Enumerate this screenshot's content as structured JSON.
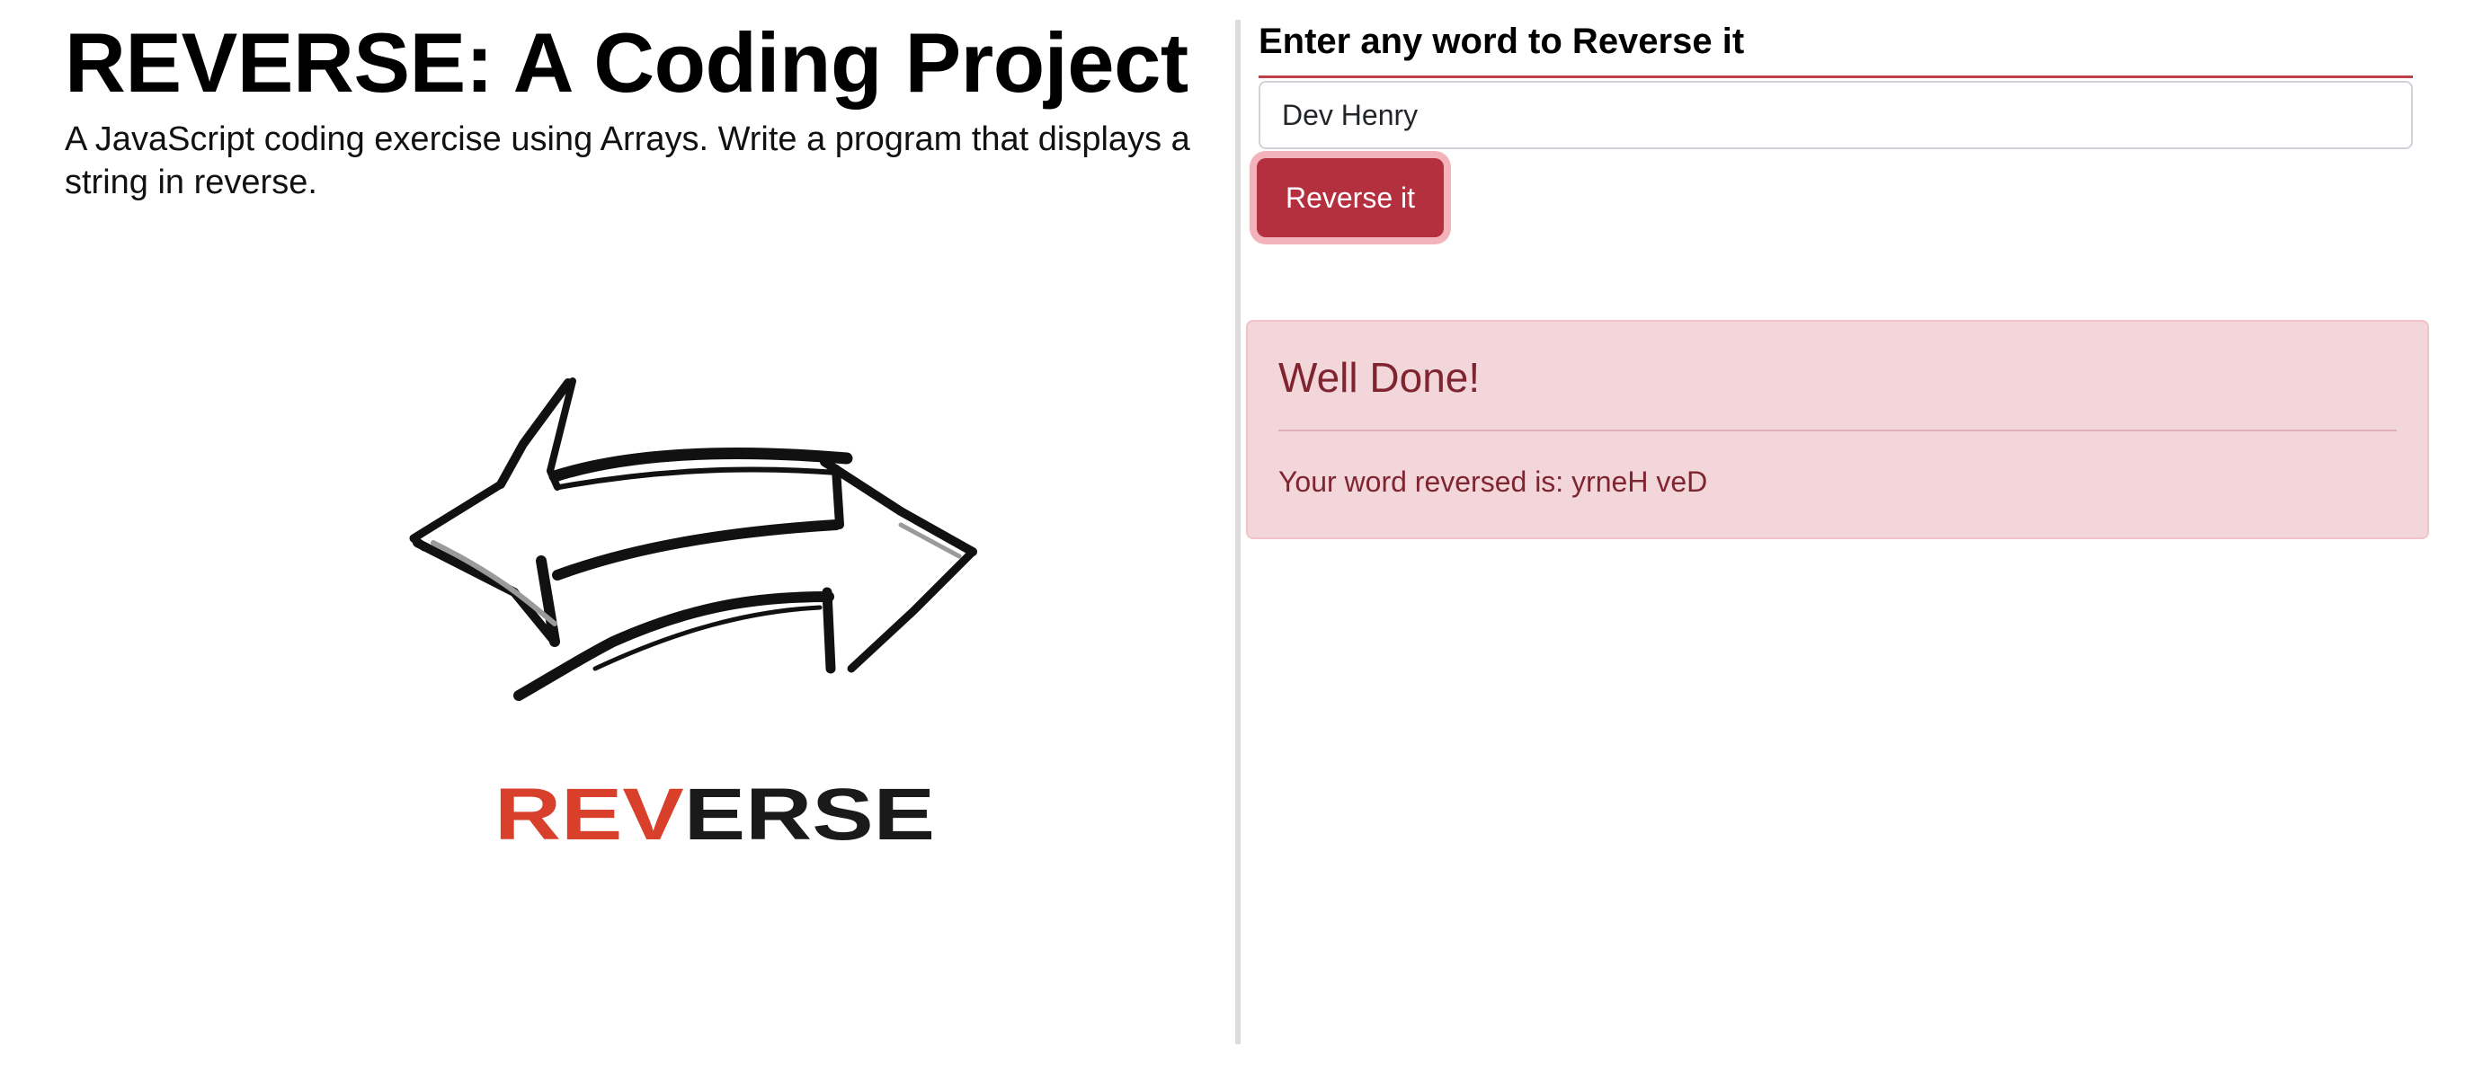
{
  "header": {
    "title": "REVERSE: A Coding Project",
    "description": "A JavaScript coding exercise using Arrays. Write a program that displays a string in reverse."
  },
  "logo": {
    "icon": "double-arrow-brush-icon",
    "word_highlight": "REV",
    "word_rest": "ERSE",
    "highlight_color": "#d9402b",
    "rest_color": "#1a1a1a"
  },
  "form": {
    "label": "Enter any word to Reverse it",
    "input_value": "Dev Henry",
    "button_label": "Reverse it",
    "accent_color": "#b5303e"
  },
  "alert": {
    "heading": "Well Done!",
    "result_text": "Your word reversed is: yrneH veD",
    "background_color": "#f3d6da",
    "text_color": "#7e2530"
  }
}
